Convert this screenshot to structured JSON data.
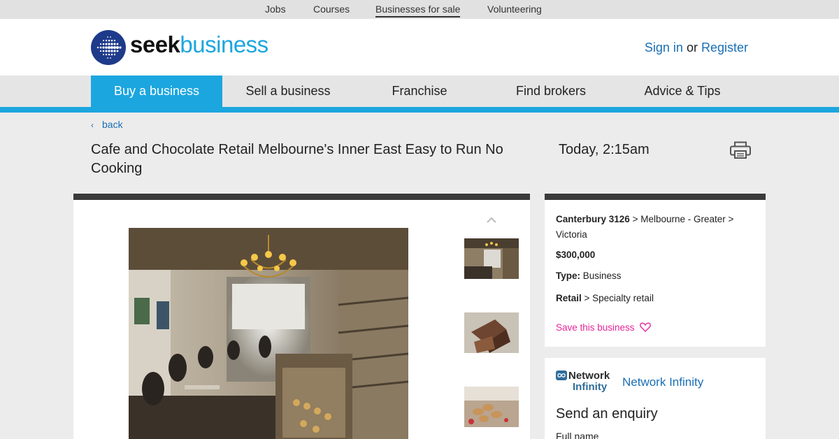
{
  "topnav": {
    "items": [
      "Jobs",
      "Courses",
      "Businesses for sale",
      "Volunteering"
    ],
    "active": "Businesses for sale"
  },
  "header": {
    "logo_seek": "seek",
    "logo_business": "business",
    "sign_in": "Sign in",
    "or": "or",
    "register": "Register"
  },
  "mainnav": {
    "items": [
      "Buy a business",
      "Sell a business",
      "Franchise",
      "Find brokers",
      "Advice & Tips"
    ],
    "active": "Buy a business"
  },
  "listing": {
    "back_label": "back",
    "title": "Cafe and Chocolate Retail Melbourne's Inner East Easy to Run No Cooking",
    "date": "Today, 2:15am",
    "location_suburb": "Canterbury 3126",
    "location_rest_1": " > Melbourne - Greater >",
    "location_rest_2": "Victoria",
    "price": "$300,000",
    "type_label": "Type:",
    "type_value": " Business",
    "category": "Retail",
    "subcategory": " > Specialty retail",
    "save_label": "Save this business"
  },
  "enquiry": {
    "agency_logo_line1": "Network",
    "agency_logo_line2": "Infinity",
    "agency_name": "Network Infinity",
    "heading": "Send an enquiry",
    "full_name_label": "Full name"
  },
  "colors": {
    "brand_blue": "#1ca6df",
    "link_blue": "#1a6fb5",
    "save_pink": "#e6259a",
    "logo_navy": "#1e3a8a"
  },
  "icons": [
    "back-chevron-icon",
    "printer-icon",
    "chevron-up-icon",
    "heart-icon",
    "seek-logo-icon"
  ]
}
